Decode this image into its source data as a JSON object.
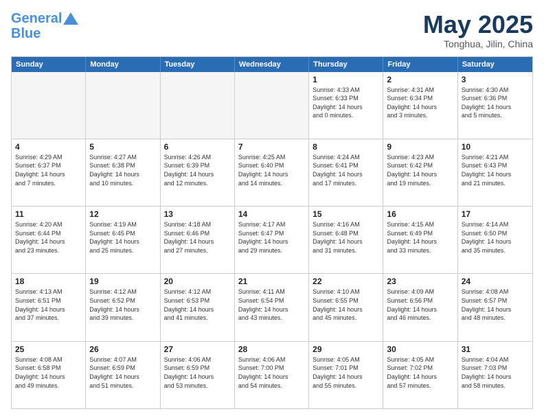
{
  "header": {
    "logo_line1": "General",
    "logo_line2": "Blue",
    "main_title": "May 2025",
    "subtitle": "Tonghua, Jilin, China"
  },
  "calendar": {
    "days_of_week": [
      "Sunday",
      "Monday",
      "Tuesday",
      "Wednesday",
      "Thursday",
      "Friday",
      "Saturday"
    ],
    "weeks": [
      [
        {
          "day": "",
          "info": "",
          "empty": true
        },
        {
          "day": "",
          "info": "",
          "empty": true
        },
        {
          "day": "",
          "info": "",
          "empty": true
        },
        {
          "day": "",
          "info": "",
          "empty": true
        },
        {
          "day": "1",
          "info": "Sunrise: 4:33 AM\nSunset: 6:33 PM\nDaylight: 14 hours\nand 0 minutes.",
          "empty": false
        },
        {
          "day": "2",
          "info": "Sunrise: 4:31 AM\nSunset: 6:34 PM\nDaylight: 14 hours\nand 3 minutes.",
          "empty": false
        },
        {
          "day": "3",
          "info": "Sunrise: 4:30 AM\nSunset: 6:36 PM\nDaylight: 14 hours\nand 5 minutes.",
          "empty": false
        }
      ],
      [
        {
          "day": "4",
          "info": "Sunrise: 4:29 AM\nSunset: 6:37 PM\nDaylight: 14 hours\nand 7 minutes.",
          "empty": false
        },
        {
          "day": "5",
          "info": "Sunrise: 4:27 AM\nSunset: 6:38 PM\nDaylight: 14 hours\nand 10 minutes.",
          "empty": false
        },
        {
          "day": "6",
          "info": "Sunrise: 4:26 AM\nSunset: 6:39 PM\nDaylight: 14 hours\nand 12 minutes.",
          "empty": false
        },
        {
          "day": "7",
          "info": "Sunrise: 4:25 AM\nSunset: 6:40 PM\nDaylight: 14 hours\nand 14 minutes.",
          "empty": false
        },
        {
          "day": "8",
          "info": "Sunrise: 4:24 AM\nSunset: 6:41 PM\nDaylight: 14 hours\nand 17 minutes.",
          "empty": false
        },
        {
          "day": "9",
          "info": "Sunrise: 4:23 AM\nSunset: 6:42 PM\nDaylight: 14 hours\nand 19 minutes.",
          "empty": false
        },
        {
          "day": "10",
          "info": "Sunrise: 4:21 AM\nSunset: 6:43 PM\nDaylight: 14 hours\nand 21 minutes.",
          "empty": false
        }
      ],
      [
        {
          "day": "11",
          "info": "Sunrise: 4:20 AM\nSunset: 6:44 PM\nDaylight: 14 hours\nand 23 minutes.",
          "empty": false
        },
        {
          "day": "12",
          "info": "Sunrise: 4:19 AM\nSunset: 6:45 PM\nDaylight: 14 hours\nand 25 minutes.",
          "empty": false
        },
        {
          "day": "13",
          "info": "Sunrise: 4:18 AM\nSunset: 6:46 PM\nDaylight: 14 hours\nand 27 minutes.",
          "empty": false
        },
        {
          "day": "14",
          "info": "Sunrise: 4:17 AM\nSunset: 6:47 PM\nDaylight: 14 hours\nand 29 minutes.",
          "empty": false
        },
        {
          "day": "15",
          "info": "Sunrise: 4:16 AM\nSunset: 6:48 PM\nDaylight: 14 hours\nand 31 minutes.",
          "empty": false
        },
        {
          "day": "16",
          "info": "Sunrise: 4:15 AM\nSunset: 6:49 PM\nDaylight: 14 hours\nand 33 minutes.",
          "empty": false
        },
        {
          "day": "17",
          "info": "Sunrise: 4:14 AM\nSunset: 6:50 PM\nDaylight: 14 hours\nand 35 minutes.",
          "empty": false
        }
      ],
      [
        {
          "day": "18",
          "info": "Sunrise: 4:13 AM\nSunset: 6:51 PM\nDaylight: 14 hours\nand 37 minutes.",
          "empty": false
        },
        {
          "day": "19",
          "info": "Sunrise: 4:12 AM\nSunset: 6:52 PM\nDaylight: 14 hours\nand 39 minutes.",
          "empty": false
        },
        {
          "day": "20",
          "info": "Sunrise: 4:12 AM\nSunset: 6:53 PM\nDaylight: 14 hours\nand 41 minutes.",
          "empty": false
        },
        {
          "day": "21",
          "info": "Sunrise: 4:11 AM\nSunset: 6:54 PM\nDaylight: 14 hours\nand 43 minutes.",
          "empty": false
        },
        {
          "day": "22",
          "info": "Sunrise: 4:10 AM\nSunset: 6:55 PM\nDaylight: 14 hours\nand 45 minutes.",
          "empty": false
        },
        {
          "day": "23",
          "info": "Sunrise: 4:09 AM\nSunset: 6:56 PM\nDaylight: 14 hours\nand 46 minutes.",
          "empty": false
        },
        {
          "day": "24",
          "info": "Sunrise: 4:08 AM\nSunset: 6:57 PM\nDaylight: 14 hours\nand 48 minutes.",
          "empty": false
        }
      ],
      [
        {
          "day": "25",
          "info": "Sunrise: 4:08 AM\nSunset: 6:58 PM\nDaylight: 14 hours\nand 49 minutes.",
          "empty": false
        },
        {
          "day": "26",
          "info": "Sunrise: 4:07 AM\nSunset: 6:59 PM\nDaylight: 14 hours\nand 51 minutes.",
          "empty": false
        },
        {
          "day": "27",
          "info": "Sunrise: 4:06 AM\nSunset: 6:59 PM\nDaylight: 14 hours\nand 53 minutes.",
          "empty": false
        },
        {
          "day": "28",
          "info": "Sunrise: 4:06 AM\nSunset: 7:00 PM\nDaylight: 14 hours\nand 54 minutes.",
          "empty": false
        },
        {
          "day": "29",
          "info": "Sunrise: 4:05 AM\nSunset: 7:01 PM\nDaylight: 14 hours\nand 55 minutes.",
          "empty": false
        },
        {
          "day": "30",
          "info": "Sunrise: 4:05 AM\nSunset: 7:02 PM\nDaylight: 14 hours\nand 57 minutes.",
          "empty": false
        },
        {
          "day": "31",
          "info": "Sunrise: 4:04 AM\nSunset: 7:03 PM\nDaylight: 14 hours\nand 58 minutes.",
          "empty": false
        }
      ]
    ]
  }
}
